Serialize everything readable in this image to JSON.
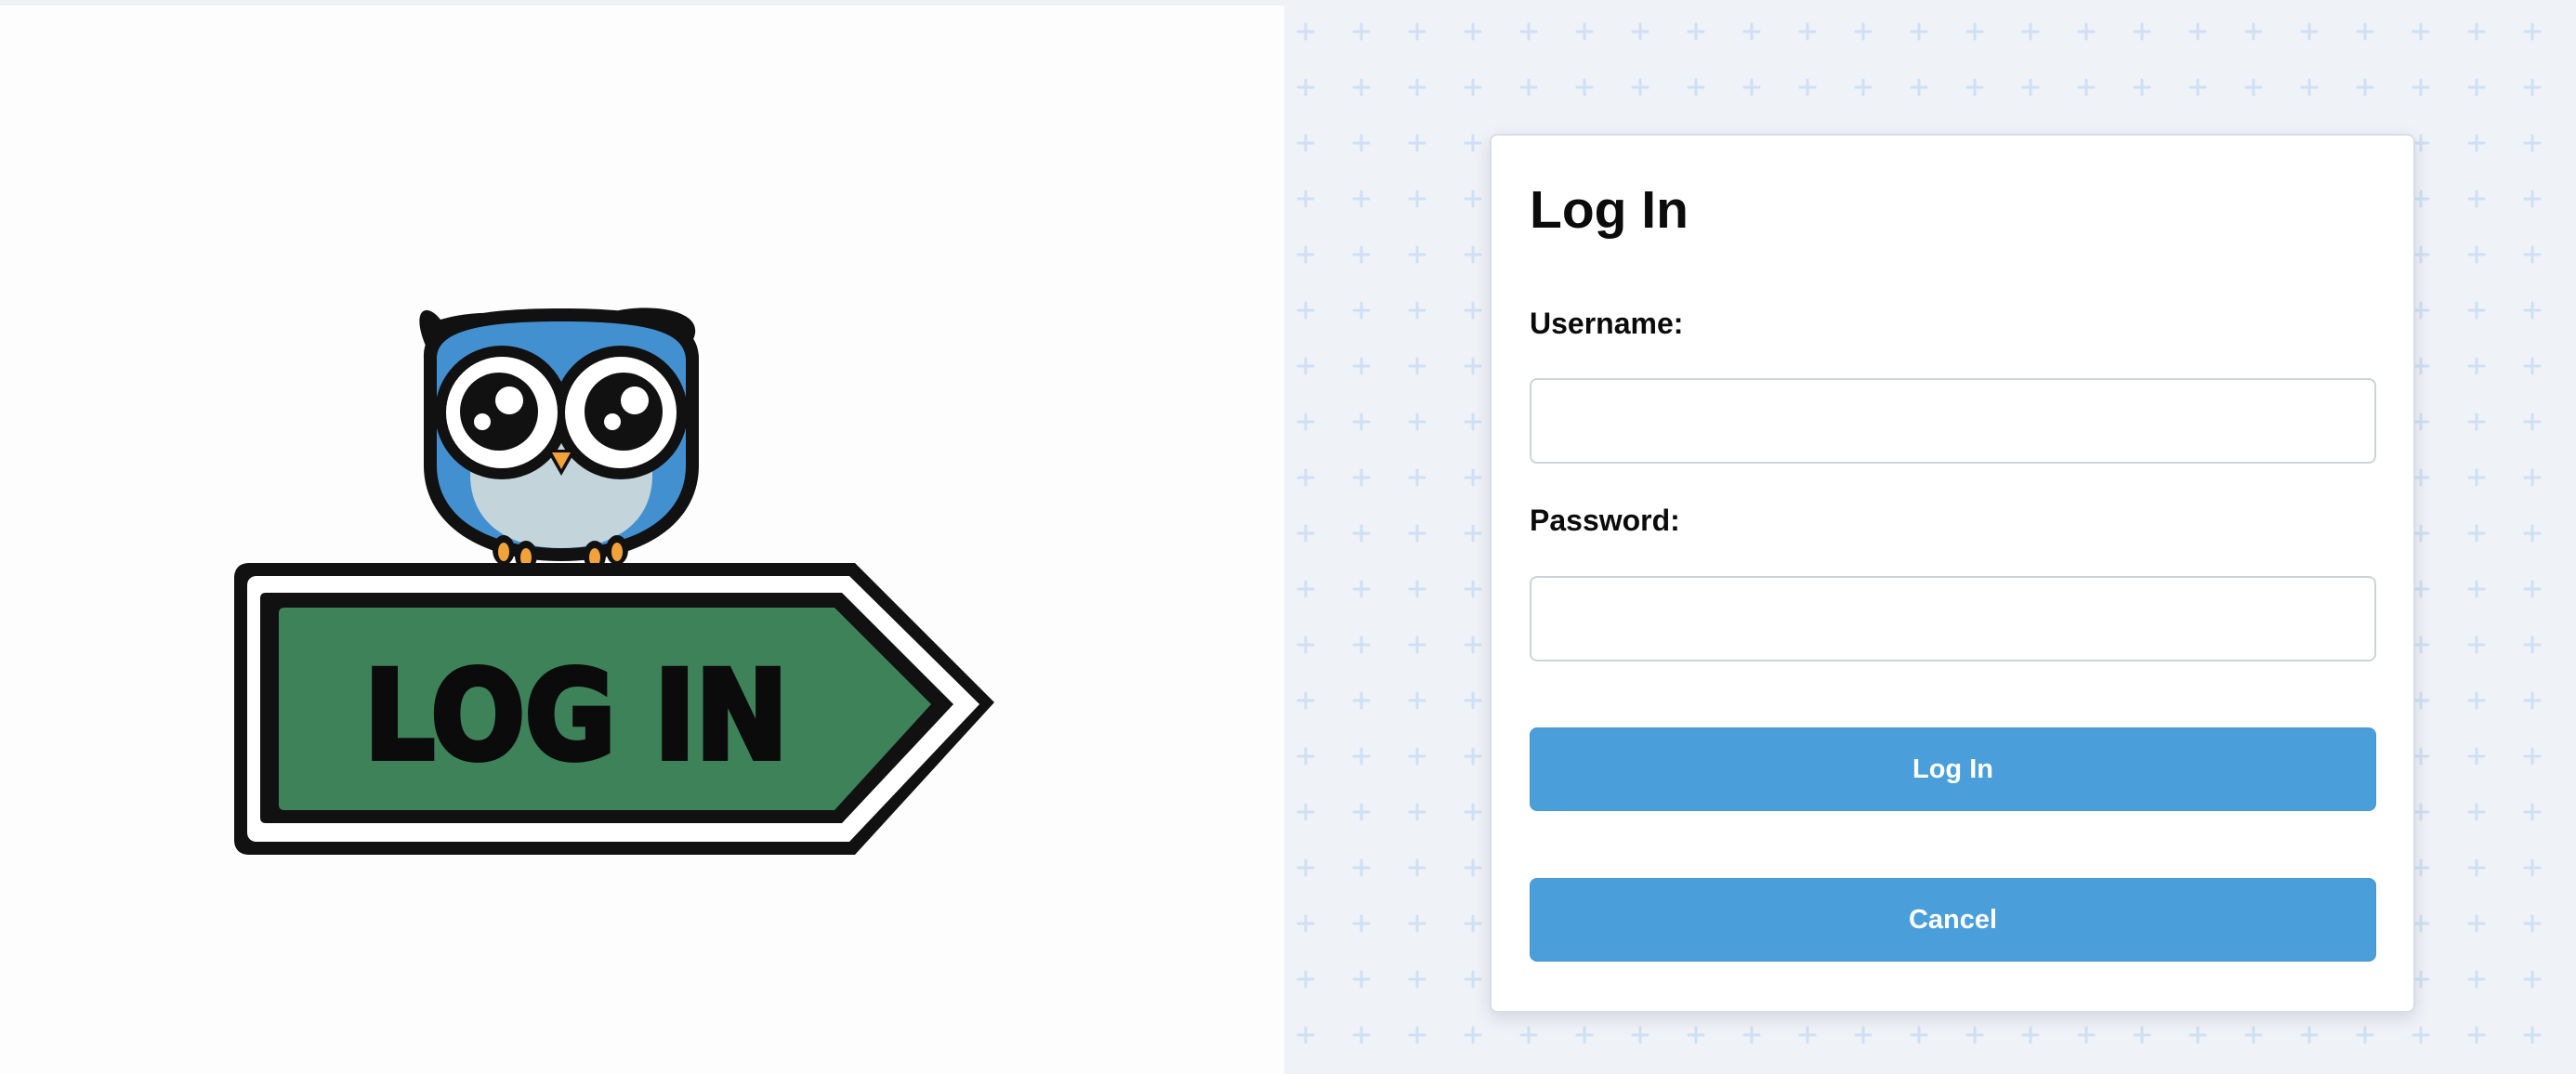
{
  "illustration": {
    "icon": "owl-mascot-icon",
    "sign_text": "LOG IN"
  },
  "login_form": {
    "title": "Log In",
    "username_label": "Username:",
    "username_value": "",
    "password_label": "Password:",
    "password_value": "",
    "login_button_label": "Log In",
    "cancel_button_label": "Cancel"
  },
  "colors": {
    "accent_button": "#4a9fda",
    "sign_green": "#3d8259",
    "owl_blue": "#4390d0",
    "owl_belly": "#c3d5db",
    "owl_feet": "#f2a23a",
    "pattern_plus": "#cfe0f4"
  }
}
